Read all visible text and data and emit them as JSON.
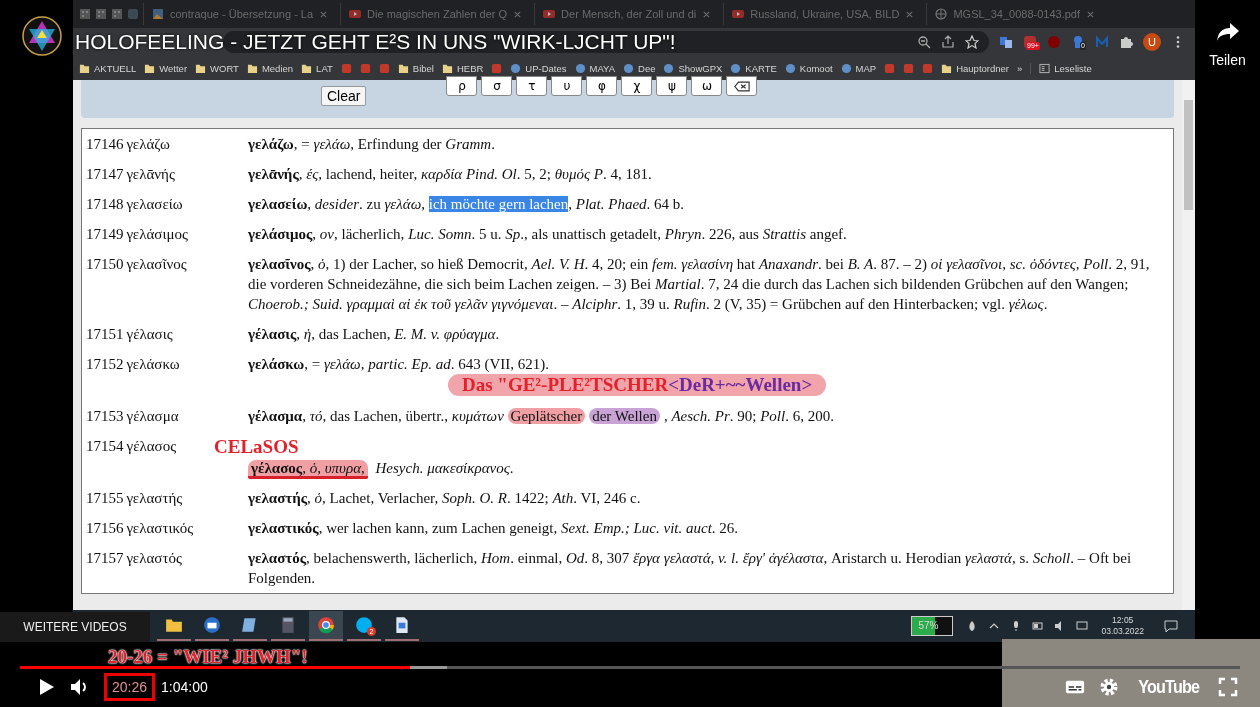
{
  "video": {
    "title": "HOLOFEELING - JETZT GEHT E²S IN UNS \"WIRK-LJCHT UP\"!",
    "share": "Teilen",
    "more_videos": "WEITERE VIDEOS"
  },
  "browser": {
    "tabs": [
      {
        "kind": "pinned"
      },
      {
        "kind": "pinned"
      },
      {
        "kind": "pinned"
      },
      {
        "kind": "pinned-d"
      },
      {
        "kind": "page",
        "label": "contraque - Übersetzung - La"
      },
      {
        "kind": "video",
        "label": "Die magischen Zahlen der Q"
      },
      {
        "kind": "video",
        "label": "Der Mensch, der Zoll und di"
      },
      {
        "kind": "video",
        "label": "Russland, Ukraine, USA, BILD"
      },
      {
        "kind": "globe",
        "label": "MGSL_34_0088-0143.pdf"
      }
    ],
    "extension_badges": [
      "99+",
      "0"
    ],
    "profile": "U",
    "bookmarks": [
      {
        "kind": "folder",
        "label": "AKTUELL"
      },
      {
        "kind": "folder",
        "label": "Wetter"
      },
      {
        "kind": "folder",
        "label": "WORT"
      },
      {
        "kind": "folder",
        "label": "Medien"
      },
      {
        "kind": "folder",
        "label": "LAT"
      },
      {
        "kind": "icon"
      },
      {
        "kind": "icon"
      },
      {
        "kind": "icon"
      },
      {
        "kind": "folder",
        "label": "Bibel"
      },
      {
        "kind": "folder",
        "label": "HEBR"
      },
      {
        "kind": "icon"
      },
      {
        "kind": "site",
        "label": "UP-Dates"
      },
      {
        "kind": "site",
        "label": "MAYA"
      },
      {
        "kind": "site",
        "label": "Dee"
      },
      {
        "kind": "site",
        "label": "ShowGPX"
      },
      {
        "kind": "site",
        "label": "KARTE"
      },
      {
        "kind": "site",
        "label": "Komoot"
      },
      {
        "kind": "site",
        "label": "MAP"
      },
      {
        "kind": "icon"
      },
      {
        "kind": "icon"
      },
      {
        "kind": "icon"
      },
      {
        "kind": "folder",
        "label": "Hauptordner"
      },
      {
        "kind": "more",
        "label": "»"
      },
      {
        "kind": "reading",
        "label": "Leseliste"
      }
    ]
  },
  "keyboard": {
    "clear": "Clear",
    "keys": [
      "ρ",
      "σ",
      "τ",
      "υ",
      "φ",
      "χ",
      "ψ",
      "ω"
    ]
  },
  "entries": [
    {
      "number": "17146",
      "headword": "γελάζω",
      "parts": [
        {
          "kind": "plain",
          "text": "**γελάζω**, = *γελάω*, Erfindung der *Gramm*."
        }
      ]
    },
    {
      "number": "17147",
      "headword": "γελᾱνής",
      "parts": [
        {
          "kind": "plain",
          "text": "**γελᾱνής**, *ές*, lachend, heiter, *καρδία Pind. Ol*. 5, 2; *θυμός P*. 4, 181."
        }
      ]
    },
    {
      "number": "17148",
      "headword": "γελασείω",
      "parts": [
        {
          "kind": "plain",
          "text": "**γελασείω**, *desider*. zu *γελάω*, "
        },
        {
          "kind": "selected",
          "text": "ich möchte gern lachen"
        },
        {
          "kind": "plain",
          "text": ", *Plat. Phaed*. 64 b."
        }
      ]
    },
    {
      "number": "17149",
      "headword": "γελάσιμος",
      "parts": [
        {
          "kind": "plain",
          "text": "**γελάσιμος**, *ον*, lächerlich, *Luc. Somn*. 5 u. *Sp*., als unattisch getadelt, *Phryn*. 226, aus *Strattis* angef."
        }
      ]
    },
    {
      "number": "17150",
      "headword": "γελασῖνος",
      "parts": [
        {
          "kind": "plain",
          "text": "**γελασῖνος**, *ὁ*, 1) der Lacher, so hieß Democrit, *Ael. V. H*. 4, 20; ein *fem. γελασίνη* hat *Anaxandr*. bei *B. A*. 87. – 2) *οἱ γελασῖνοι, sc. ὀδόντες*, *Poll*. 2, 91, die vorderen Schneidezähne, die sich beim Lachen zeigen. – 3) Bei *Martial*. 7, 24 die durch das Lachen sich bildenden Grübchen auf den Wangen; *Choerob.; Suid. γραμμαὶ αἱ ἐκ τοῦ γελᾶν γιγνόμεναι*. – *Alciphr*. 1, 39 u. *Rufin*. 2 (V, 35) = Grübchen auf den Hinterbacken; vgl. *γέλως*."
        }
      ]
    },
    {
      "number": "17151",
      "headword": "γέλασις",
      "parts": [
        {
          "kind": "plain",
          "text": "**γέλασις**, *ἡ*, das Lachen, *E. M. v. φρύαγμα*."
        }
      ]
    },
    {
      "number": "17152",
      "headword": "γελάσκω",
      "parts": [
        {
          "kind": "plain",
          "text": "**γελάσκω**, = *γελάω*, *partic. Ep. ad*. 643 (VII, 621)."
        }
      ],
      "annotation": {
        "kind": "pill",
        "parts": [
          {
            "text": "Das \"GE²-PLE²TSCHER",
            "kind": "main"
          },
          {
            "text": "<DeR+~~Wellen>",
            "kind": "tag"
          }
        ]
      }
    },
    {
      "number": "17153",
      "headword": "γέλασμα",
      "parts": [
        {
          "kind": "plain",
          "text": "**γέλασμα**, *τό*, das Lachen, übertr., *κυμάτων* "
        },
        {
          "kind": "marker",
          "text": "Geplätscher",
          "color": "#f0a0a4"
        },
        {
          "kind": "marker",
          "text": "der Wellen",
          "color": "#c9a3d6"
        },
        {
          "kind": "plain",
          "text": ", *Aesch. Pr*. 90; *Poll*. 6, 200."
        }
      ]
    },
    {
      "number": "17154",
      "headword": "γέλασος",
      "annotation": {
        "kind": "label",
        "parts": [
          {
            "text": "CELaSOS",
            "color": "#e3212b"
          }
        ]
      },
      "parts": [
        {
          "kind": "underlined",
          "text": "**γέλασος**, *ὁ*, *υπυρα*,",
          "color": "#f0a0a4"
        },
        {
          "kind": "plain",
          "text": " *Hesych. μακεσίκρανος*."
        }
      ]
    },
    {
      "number": "17155",
      "headword": "γελαστής",
      "parts": [
        {
          "kind": "plain",
          "text": "**γελαστής**, *ὁ*, Lachet, Verlacher, *Soph. O. R*. 1422; *Ath*. VI, 246 c."
        }
      ]
    },
    {
      "number": "17156",
      "headword": "γελαστικός",
      "parts": [
        {
          "kind": "plain",
          "text": "**γελαστικός**, wer lachen kann, zum Lachen geneigt, *Sext. Emp.; Luc. vit. auct*. 26."
        }
      ]
    },
    {
      "number": "17157",
      "headword": "γελαστός",
      "parts": [
        {
          "kind": "plain",
          "text": "**γελαστός**, belachenswerth, lächerlich, *Hom*. einmal, *Od*. 8, 307 *ἔργα γελαστά*, *v. l. ἔργ' ἀγέλαστα*, Aristarch u. Herodian *γελαστά*, s. *Scholl*. – Oft bei Folgenden."
        }
      ]
    }
  ],
  "taskbar": {
    "apps": [
      {
        "kind": "folder",
        "selected": false
      },
      {
        "kind": "mail",
        "selected": false
      },
      {
        "kind": "notepad",
        "selected": false
      },
      {
        "kind": "calculator",
        "selected": false
      },
      {
        "kind": "browser",
        "selected": true
      },
      {
        "kind": "chat",
        "selected": false,
        "badge": "2"
      },
      {
        "kind": "document",
        "selected": false
      }
    ],
    "battery": {
      "reading": "57%",
      "level": 0.57
    },
    "time": "12:05",
    "date": "03.03.2022"
  },
  "player": {
    "annotation": "20-26 = \"WIE² JHWH\"!",
    "level": 0.32,
    "elapsed": "20:26",
    "duration": "1:04:00",
    "logo": "YouTube"
  }
}
